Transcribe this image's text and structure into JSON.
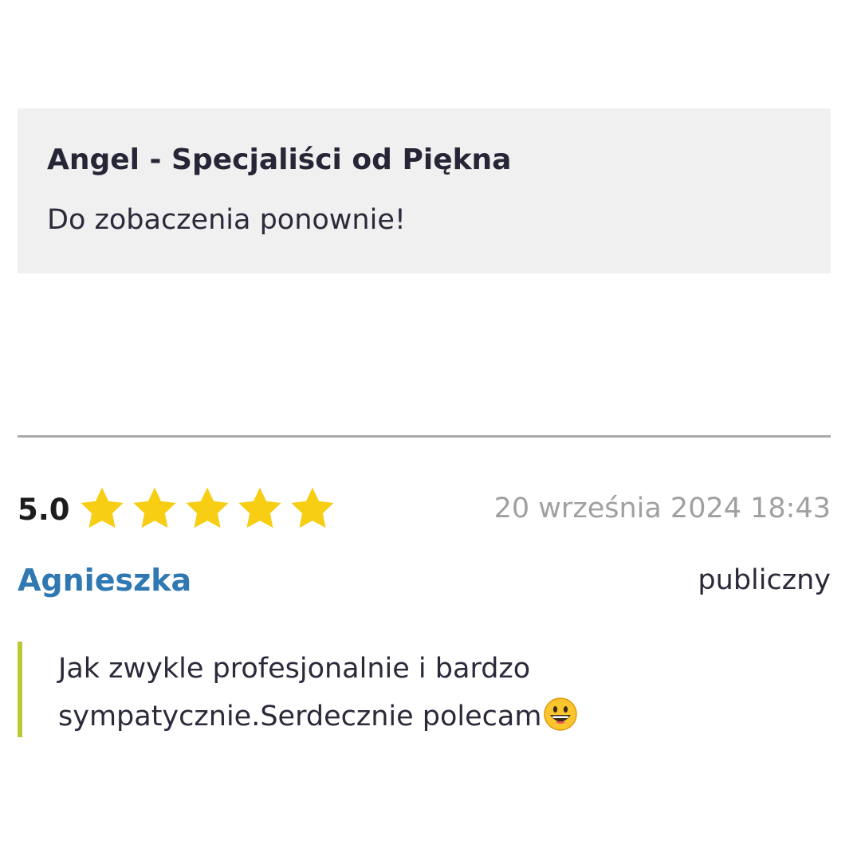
{
  "reply": {
    "author": "Angel - Specjaliści od Piękna",
    "text": "Do zobaczenia ponownie!"
  },
  "review": {
    "rating": "5.0",
    "rating_value": 5,
    "rating_max": 5,
    "date": "20 września 2024 18:43",
    "reviewer": "Agnieszka",
    "visibility": "publiczny",
    "text": "Jak zwykle profesjonalnie i bardzo sympatycznie.Serdecznie polecam",
    "emoji_icon": "grinning-face-emoji"
  },
  "colors": {
    "star": "#f7ce14",
    "reviewer_name": "#2f78b1",
    "quote_border": "#b7c934",
    "reply_background": "#f0f0f0"
  }
}
